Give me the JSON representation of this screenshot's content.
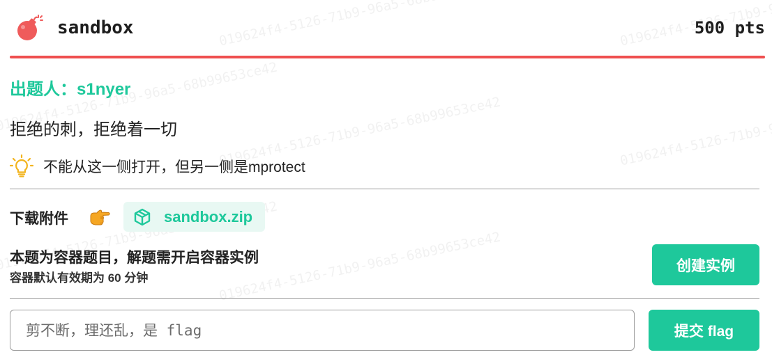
{
  "watermark": "019624f4-5126-71b9-96a5-68b99653ce42",
  "challenge": {
    "title": "sandbox",
    "points": "500 pts",
    "author": "出题人：s1nyer",
    "description": "拒绝的刺，拒绝着一切",
    "hint": "不能从这一侧打开，但另一侧是mprotect"
  },
  "attachment": {
    "label": "下载附件",
    "file_name": "sandbox.zip"
  },
  "container": {
    "title": "本题为容器题目，解题需开启容器实例",
    "subtitle": "容器默认有效期为 60 分钟",
    "create_button": "创建实例"
  },
  "flag_form": {
    "placeholder": "剪不断，理还乱，是 flag",
    "submit_button": "提交 flag"
  },
  "colors": {
    "accent": "#1ec89b",
    "danger": "#ef4f4f",
    "chip_bg": "#e8f8f3"
  },
  "icons": {
    "challenge": "bomb-icon",
    "hint": "lightbulb-icon",
    "attachment": "pointing-hand-icon",
    "file": "package-icon"
  }
}
